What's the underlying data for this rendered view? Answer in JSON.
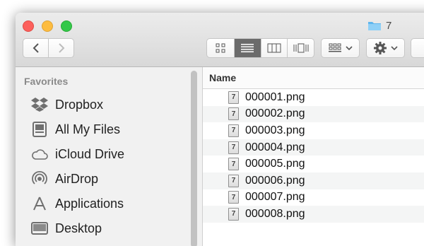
{
  "window": {
    "title": "7",
    "folder_icon": "folder-icon"
  },
  "toolbar": {
    "back_icon": "chevron-left-icon",
    "forward_icon": "chevron-right-icon",
    "view_modes": [
      "icon-view",
      "list-view",
      "column-view",
      "coverflow-view"
    ],
    "active_view": "list-view",
    "arrange_icon": "arrange-grid-icon",
    "action_icon": "gear-icon"
  },
  "sidebar": {
    "heading": "Favorites",
    "items": [
      {
        "label": "Dropbox",
        "icon": "dropbox-icon"
      },
      {
        "label": "All My Files",
        "icon": "all-files-icon"
      },
      {
        "label": "iCloud Drive",
        "icon": "cloud-icon"
      },
      {
        "label": "AirDrop",
        "icon": "airdrop-icon"
      },
      {
        "label": "Applications",
        "icon": "applications-icon"
      },
      {
        "label": "Desktop",
        "icon": "desktop-icon"
      }
    ]
  },
  "file_list": {
    "column_name": "Name",
    "icon_glyph": "7",
    "files": [
      "000001.png",
      "000002.png",
      "000003.png",
      "000004.png",
      "000005.png",
      "000006.png",
      "000007.png",
      "000008.png"
    ]
  },
  "colors": {
    "close": "#fc605c",
    "minimize": "#fdbc40",
    "maximize": "#34c84a",
    "folder": "#5fb6ee",
    "active_segment": "#6b6b6b"
  }
}
